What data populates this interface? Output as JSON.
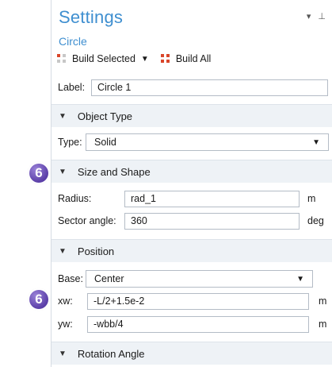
{
  "window": {
    "title": "Settings",
    "dropdown_glyph": "▾",
    "pin_glyph": "⊥"
  },
  "node": {
    "name": "Circle"
  },
  "toolbar": {
    "build_selected_label": "Build Selected",
    "build_all_label": "Build All",
    "build_selected_icon": "build-selected-icon",
    "build_all_icon": "build-all-icon"
  },
  "label": {
    "caption": "Label:",
    "value": "Circle 1"
  },
  "sections": {
    "object_type": "Object Type",
    "size_and_shape": "Size and Shape",
    "position": "Position",
    "rotation_angle": "Rotation Angle"
  },
  "object_type": {
    "caption": "Type:",
    "value": "Solid"
  },
  "size_and_shape": {
    "radius_caption": "Radius:",
    "radius_value": "rad_1",
    "radius_unit": "m",
    "sector_caption": "Sector angle:",
    "sector_value": "360",
    "sector_unit": "deg"
  },
  "position": {
    "base_caption": "Base:",
    "base_value": "Center",
    "xw_caption": "xw:",
    "xw_value": "-L/2+1.5e-2",
    "xw_unit": "m",
    "yw_caption": "yw:",
    "yw_value": "-wbb/4",
    "yw_unit": "m"
  },
  "callouts": {
    "badge_1": "6",
    "badge_2": "6"
  },
  "colors": {
    "title_blue": "#3f8fd0",
    "section_bg": "#eef2f6",
    "badge_purple": "#5b3fa8",
    "build_red": "#d9462a"
  }
}
